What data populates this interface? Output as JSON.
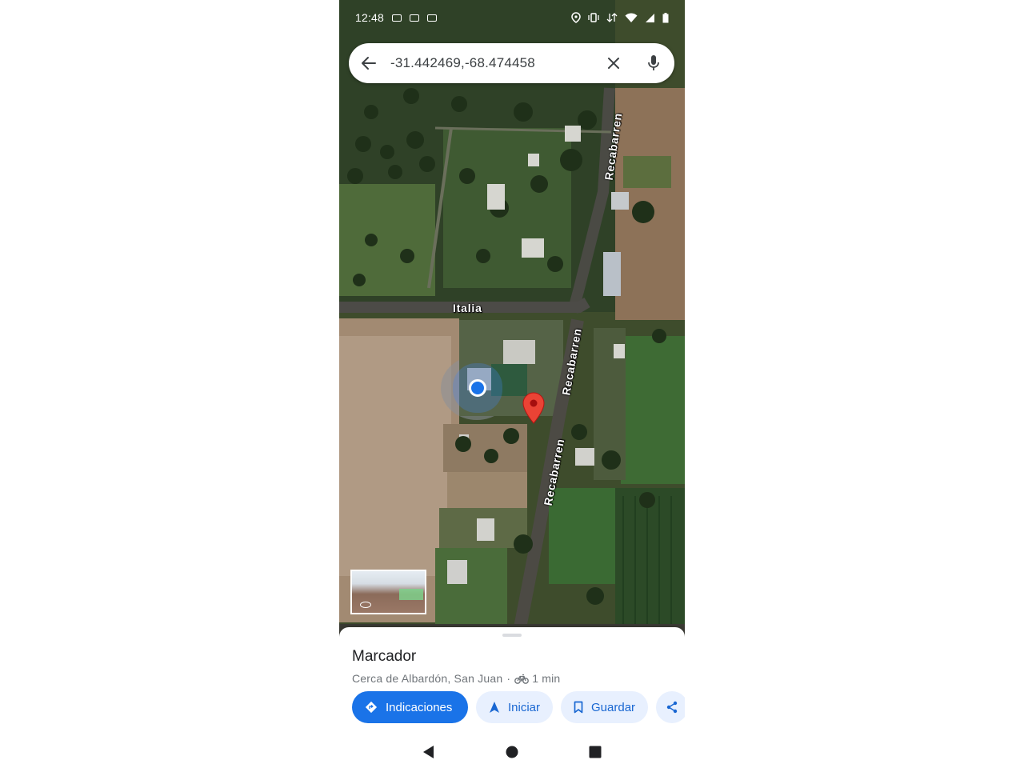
{
  "status_bar": {
    "time": "12:48",
    "notification_icons": [
      "ring-icon",
      "ring-icon",
      "ring-icon"
    ],
    "right_icons": [
      "location-icon",
      "vibrate-icon",
      "data-icon",
      "wifi-icon",
      "signal-icon",
      "battery-icon"
    ]
  },
  "search": {
    "query": "-31.442469,-68.474458"
  },
  "map": {
    "streets": [
      "Recabarren",
      "Italia",
      "Recabarren",
      "Recabarren"
    ]
  },
  "place": {
    "title": "Marcador",
    "location": "Cerca de Albardón, San Juan",
    "separator": "·",
    "travel_time": "1 min",
    "travel_mode_icon": "bike-icon"
  },
  "actions": [
    {
      "label": "Indicaciones",
      "icon": "directions-icon"
    },
    {
      "label": "Iniciar",
      "icon": "navigation-arrow-icon"
    },
    {
      "label": "Guardar",
      "icon": "bookmark-icon"
    },
    {
      "label": "",
      "icon": "share-icon"
    }
  ],
  "colors": {
    "accent": "#1a73e8",
    "chip_bg": "#e8f0fe",
    "pin": "#ea4335"
  }
}
